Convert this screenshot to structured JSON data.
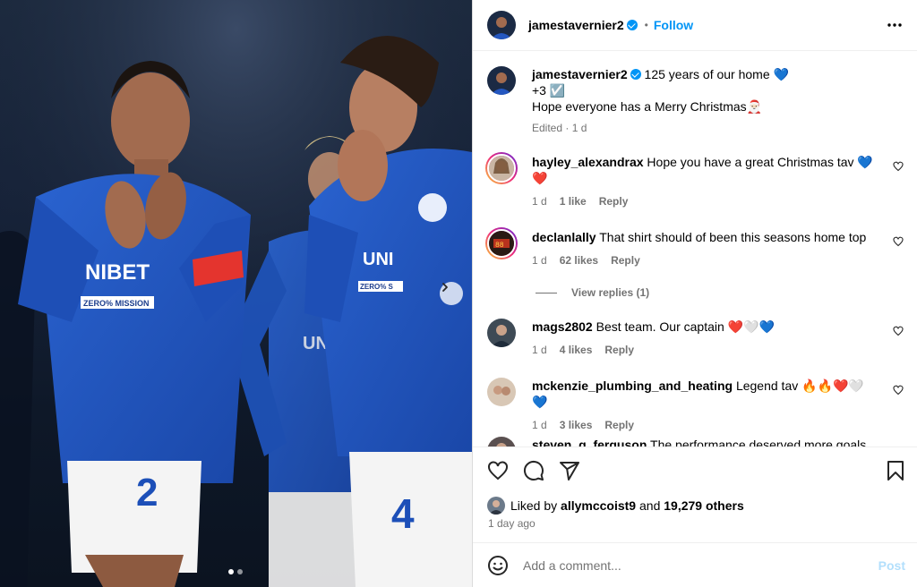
{
  "post": {
    "username": "jamestavernier2",
    "follow_label": "Follow",
    "separator": "•",
    "caption": {
      "text": "125 years of our home 💙",
      "line2": "+3 ☑️",
      "line3": "Hope everyone has a Merry Christmas🎅🏻",
      "edited": "Edited · 1 d"
    },
    "photo": {
      "shirt_sponsor": "UNIBET",
      "sub_sponsor": "ZERO% MISSION",
      "numbers": [
        "2",
        "4"
      ],
      "current_slide": 1,
      "total_slides": 2
    }
  },
  "comments": [
    {
      "username": "hayley_alexandrax",
      "text": "Hope you have a great Christmas tav 💙❤️",
      "time": "1 d",
      "likes": "1 like",
      "reply": "Reply"
    },
    {
      "username": "declanlally",
      "text": "That shirt should of been this seasons home top",
      "time": "1 d",
      "likes": "62 likes",
      "reply": "Reply",
      "view_replies": "View replies (1)"
    },
    {
      "username": "mags2802",
      "text": "Best team. Our captain ❤️🤍💙",
      "time": "1 d",
      "likes": "4 likes",
      "reply": "Reply"
    },
    {
      "username": "mckenzie_plumbing_and_heating",
      "text": "Legend tav 🔥🔥❤️🤍💙",
      "time": "1 d",
      "likes": "3 likes",
      "reply": "Reply"
    },
    {
      "username": "steven_g_ferguson",
      "text": "The performance deserved more goals"
    }
  ],
  "likes": {
    "prefix": "Liked by",
    "user": "allymccoist9",
    "and": "and",
    "others": "19,279 others",
    "ago": "1 day ago"
  },
  "add_comment": {
    "placeholder": "Add a comment...",
    "post_label": "Post"
  },
  "colors": {
    "accent": "#0095f6",
    "kit_blue": "#1c4fb8",
    "post_disabled": "#b2dffc"
  },
  "icons": [
    "heart-icon",
    "comment-icon",
    "share-icon",
    "bookmark-icon",
    "more-icon",
    "emoji-icon",
    "chevron-right-icon"
  ]
}
